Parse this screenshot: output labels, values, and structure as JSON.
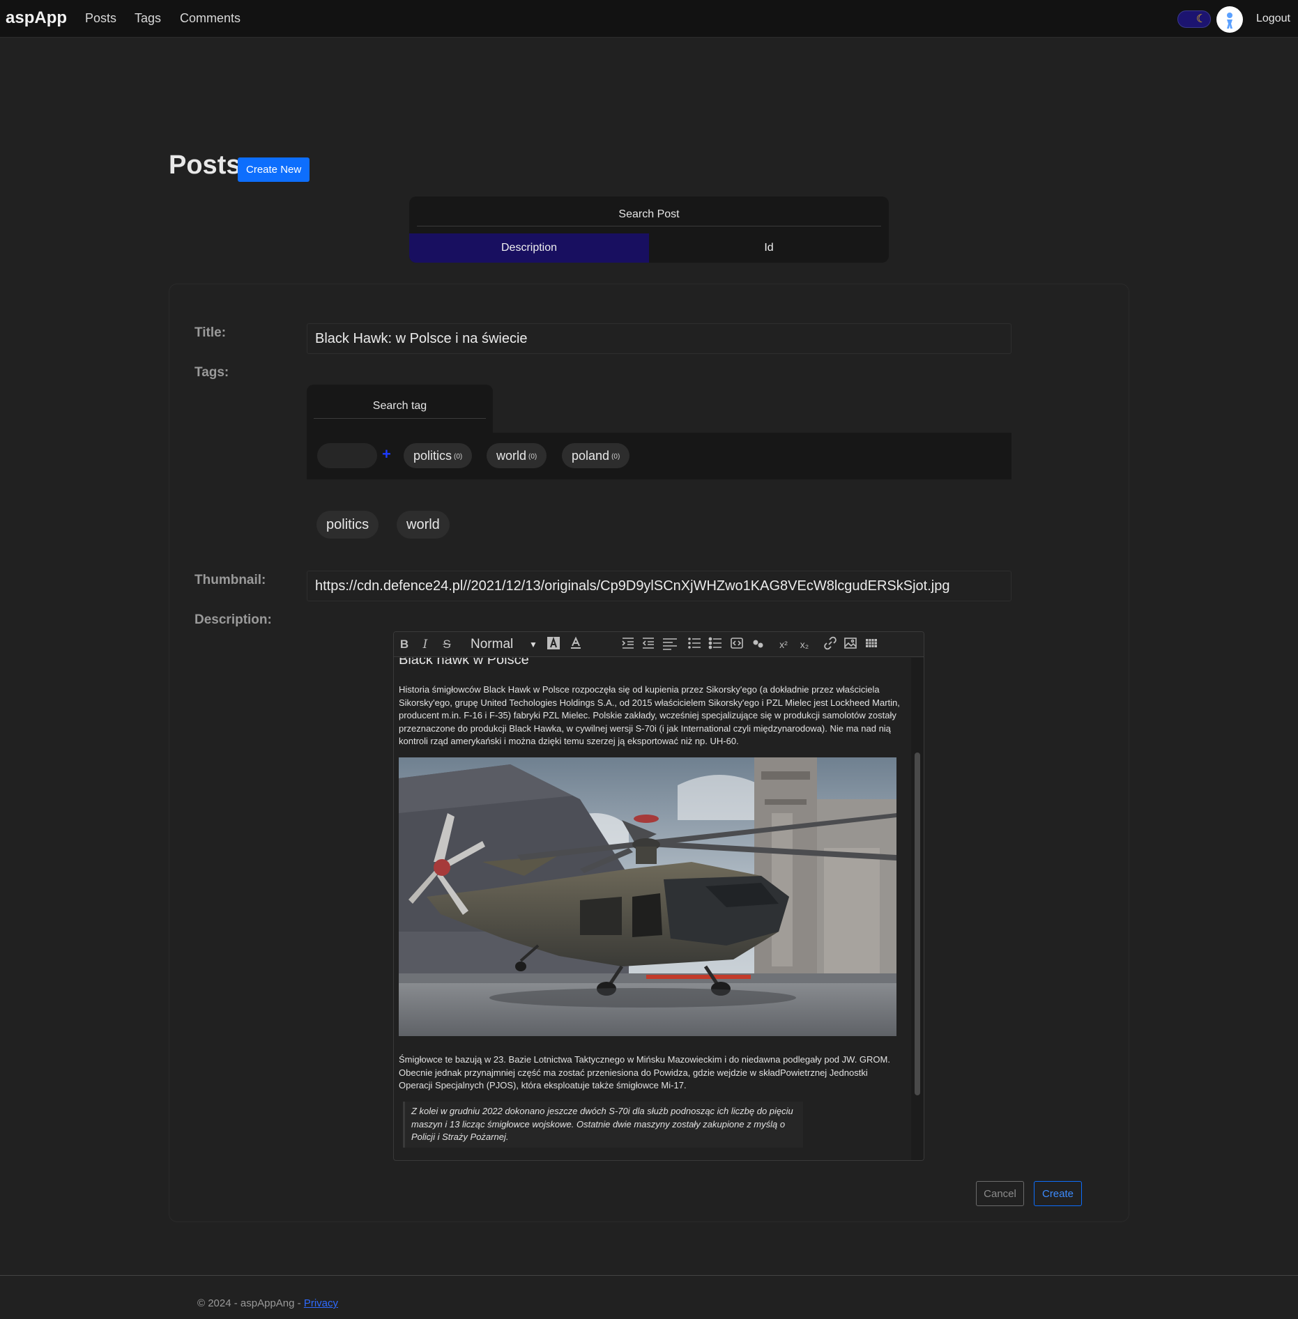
{
  "navbar": {
    "brand": "aspApp",
    "links": [
      "Posts",
      "Tags",
      "Comments"
    ],
    "theme_icon": "moon-icon",
    "logout": "Logout"
  },
  "header": {
    "title": "Posts",
    "create_new": "Create New"
  },
  "search_post": {
    "placeholder": "Search Post",
    "tabs": [
      {
        "label": "Description",
        "active": true
      },
      {
        "label": "Id",
        "active": false
      }
    ]
  },
  "form": {
    "title_label": "Title:",
    "title_value": "Black Hawk: w Polsce i na świecie",
    "tags_label": "Tags:",
    "tag_search_placeholder": "Search tag",
    "tag_add_icon": "+",
    "available_tags": [
      {
        "name": "politics",
        "count": "(0)"
      },
      {
        "name": "world",
        "count": "(0)"
      },
      {
        "name": "poland",
        "count": "(0)"
      }
    ],
    "selected_tags": [
      "politics",
      "world"
    ],
    "thumbnail_label": "Thumbnail:",
    "thumbnail_value": "https://cdn.defence24.pl//2021/12/13/originals/Cp9D9ylSCnXjWHZwo1KAG8VEcW8lcgudERSkSjot.jpg",
    "description_label": "Description:",
    "cancel": "Cancel",
    "create": "Create"
  },
  "editor": {
    "toolbar": {
      "bold": "B",
      "italic": "I",
      "strike": "S",
      "heading_select": "Normal",
      "superscript": "x²",
      "subscript": "x₂"
    },
    "heading": "Black hawk w Polsce",
    "paragraph1": "Historia śmigłowców Black Hawk w Polsce rozpoczęła się od kupienia przez Sikorsky'ego (a dokładnie przez właściciela Sikorsky'ego, grupę United Techologies Holdings S.A., od 2015 właścicielem Sikorsky'ego i PZL Mielec jest Lockheed Martin, producent m.in. F-16 i F-35) fabryki PZL Mielec. Polskie zakłady, wcześniej specjalizujące się w produkcji samolotów zostały przeznaczone do produkcji Black Hawka, w cywilnej wersji S-70i (i jak International czyli międzynarodowa). Nie ma nad nią kontroli rząd amerykański i można dzięki temu szerzej ją eksportować niż np. UH-60.",
    "paragraph2": "Śmigłowce te bazują w 23. Bazie Lotnictwa Taktycznego w Mińsku Mazowieckim i do niedawna podlegały pod JW. GROM. Obecnie jednak przynajmniej część ma zostać przeniesiona do Powidza, gdzie wejdzie w składPowietrznej Jednostki Operacji Specjalnych (PJOS), która eksploatuje także śmigłowce Mi-17.",
    "quote": "Z kolei w grudniu 2022 dokonano jeszcze dwóch S-70i dla służb podnosząc ich liczbę do pięciu maszyn i 13 licząc śmigłowce wojskowe. Ostatnie dwie maszyny zostały zakupione z myślą o Policji i Straży Pożarnej."
  },
  "footer": {
    "copyright": "© 2024 - aspAppAng - ",
    "privacy": "Privacy"
  },
  "colors": {
    "primary": "#0d6efd",
    "active_tab": "#180f60",
    "background": "#212121",
    "navbar": "#121212"
  }
}
